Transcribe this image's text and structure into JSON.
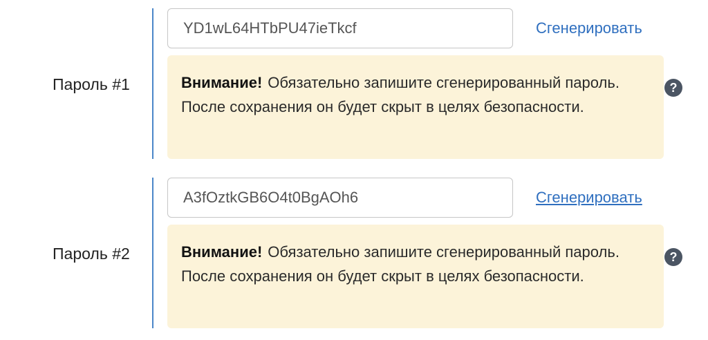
{
  "passwords": [
    {
      "label": "Пароль #1",
      "value": "YD1wL64HTbPU47ieTkcf",
      "generate_label": "Сгенерировать",
      "warning_title": "Внимание!",
      "warning_text": "Обязательно запишите сгенерированный пароль. После сохранения он будет скрыт в целях безопасности.",
      "help_icon": "question-circle-icon"
    },
    {
      "label": "Пароль #2",
      "value": "A3fOztkGB6O4t0BgAOh6",
      "generate_label": "Сгенерировать",
      "warning_title": "Внимание!",
      "warning_text": "Обязательно запишите сгенерированный пароль. После сохранения он будет скрыт в целях безопасности.",
      "help_icon": "question-circle-icon"
    }
  ],
  "colors": {
    "accent": "#2f6fbf",
    "divider": "#4a86c8",
    "warning_bg": "#fcf3d9",
    "help_icon_bg": "#4b5563"
  }
}
